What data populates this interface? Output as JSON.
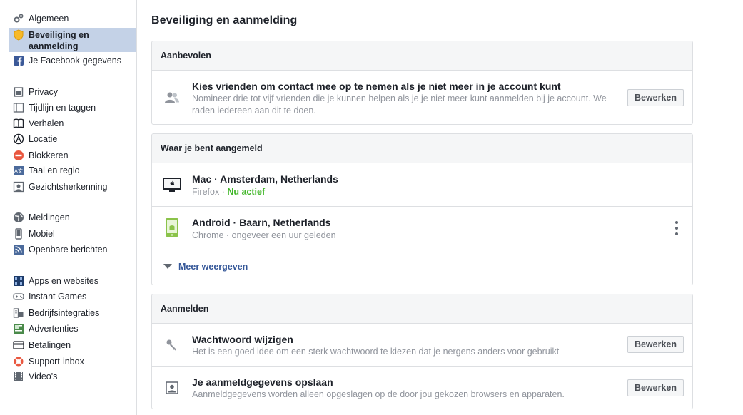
{
  "sidebar": {
    "items": [
      {
        "label": "Algemeen",
        "icon": "gears-icon"
      },
      {
        "label": "Beveiliging en aanmelding",
        "icon": "shield-icon",
        "selected": true
      },
      {
        "label": "Je Facebook-gegevens",
        "icon": "facebook-icon"
      },
      {
        "label": "Privacy",
        "icon": "lock-icon"
      },
      {
        "label": "Tijdlijn en taggen",
        "icon": "timeline-icon"
      },
      {
        "label": "Verhalen",
        "icon": "book-icon"
      },
      {
        "label": "Locatie",
        "icon": "location-icon"
      },
      {
        "label": "Blokkeren",
        "icon": "block-icon"
      },
      {
        "label": "Taal en regio",
        "icon": "language-icon"
      },
      {
        "label": "Gezichtsherkenning",
        "icon": "face-icon"
      },
      {
        "label": "Meldingen",
        "icon": "globe-icon"
      },
      {
        "label": "Mobiel",
        "icon": "mobile-icon"
      },
      {
        "label": "Openbare berichten",
        "icon": "rss-icon"
      },
      {
        "label": "Apps en websites",
        "icon": "apps-icon"
      },
      {
        "label": "Instant Games",
        "icon": "gamepad-icon"
      },
      {
        "label": "Bedrijfsintegraties",
        "icon": "business-icon"
      },
      {
        "label": "Advertenties",
        "icon": "ads-icon"
      },
      {
        "label": "Betalingen",
        "icon": "card-icon"
      },
      {
        "label": "Support-inbox",
        "icon": "lifebuoy-icon"
      },
      {
        "label": "Video's",
        "icon": "film-icon"
      }
    ]
  },
  "page": {
    "title": "Beveiliging en aanmelding"
  },
  "recommended": {
    "header": "Aanbevolen",
    "title": "Kies vrienden om contact mee op te nemen als je niet meer in je account kunt",
    "desc_line1": "Nomineer drie tot vijf vrienden die je kunnen helpen als je je niet meer kunt aanmelden bij je account. We",
    "desc_line2": "raden iedereen aan dit te doen.",
    "button": "Bewerken"
  },
  "sessions": {
    "header": "Waar je bent aangemeld",
    "items": [
      {
        "device": "Mac · Amsterdam, Netherlands",
        "browser": "Firefox",
        "sep": " · ",
        "status": "Nu actief"
      },
      {
        "device": "Android · Baarn, Netherlands",
        "browser": "Chrome · ongeveer een uur geleden"
      }
    ],
    "more": "Meer weergeven"
  },
  "login": {
    "header": "Aanmelden",
    "items": [
      {
        "title": "Wachtwoord wijzigen",
        "desc": "Het is een goed idee om een sterk wachtwoord te kiezen dat je nergens anders voor gebruikt",
        "button": "Bewerken"
      },
      {
        "title": "Je aanmeldgegevens opslaan",
        "desc": "Aanmeldgegevens worden alleen opgeslagen op de door jou gekozen browsers en apparaten.",
        "button": "Bewerken"
      }
    ]
  },
  "colors": {
    "accent": "#365899",
    "active": "#42b72a",
    "selected_bg": "#c4d2e7"
  }
}
